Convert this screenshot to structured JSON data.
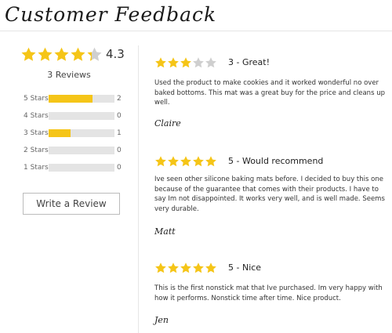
{
  "header": {
    "title": "Customer Feedback"
  },
  "summary": {
    "average": "4.3",
    "average_value": 4.3,
    "reviews_label": "3 Reviews",
    "star_color": "#f5c518",
    "empty_star_color": "#cfcfcf",
    "breakdown": [
      {
        "label": "5 Stars",
        "count": "2",
        "fraction": 0.6667
      },
      {
        "label": "4 Stars",
        "count": "0",
        "fraction": 0
      },
      {
        "label": "3 Stars",
        "count": "1",
        "fraction": 0.3333
      },
      {
        "label": "2 Stars",
        "count": "0",
        "fraction": 0
      },
      {
        "label": "1 Stars",
        "count": "0",
        "fraction": 0
      }
    ],
    "write_review_label": "Write a Review"
  },
  "reviews": [
    {
      "rating": 3,
      "title": "3 - Great!",
      "body": "Used the product to make cookies and it worked wonderful no over baked bottoms. This mat was a great buy for the price and cleans up well.",
      "author": "Claire"
    },
    {
      "rating": 5,
      "title": "5 - Would recommend",
      "body": "Ive seen other silicone baking mats before. I decided to buy this one because of the guarantee that comes with their products. I have to say Im not disappointed. It works very well, and is well made. Seems very durable.",
      "author": "Matt"
    },
    {
      "rating": 5,
      "title": "5 - Nice",
      "body": "This is the first nonstick mat that Ive purchased. Im very happy with how it performs. Nonstick time after time. Nice product.",
      "author": "Jen"
    }
  ]
}
